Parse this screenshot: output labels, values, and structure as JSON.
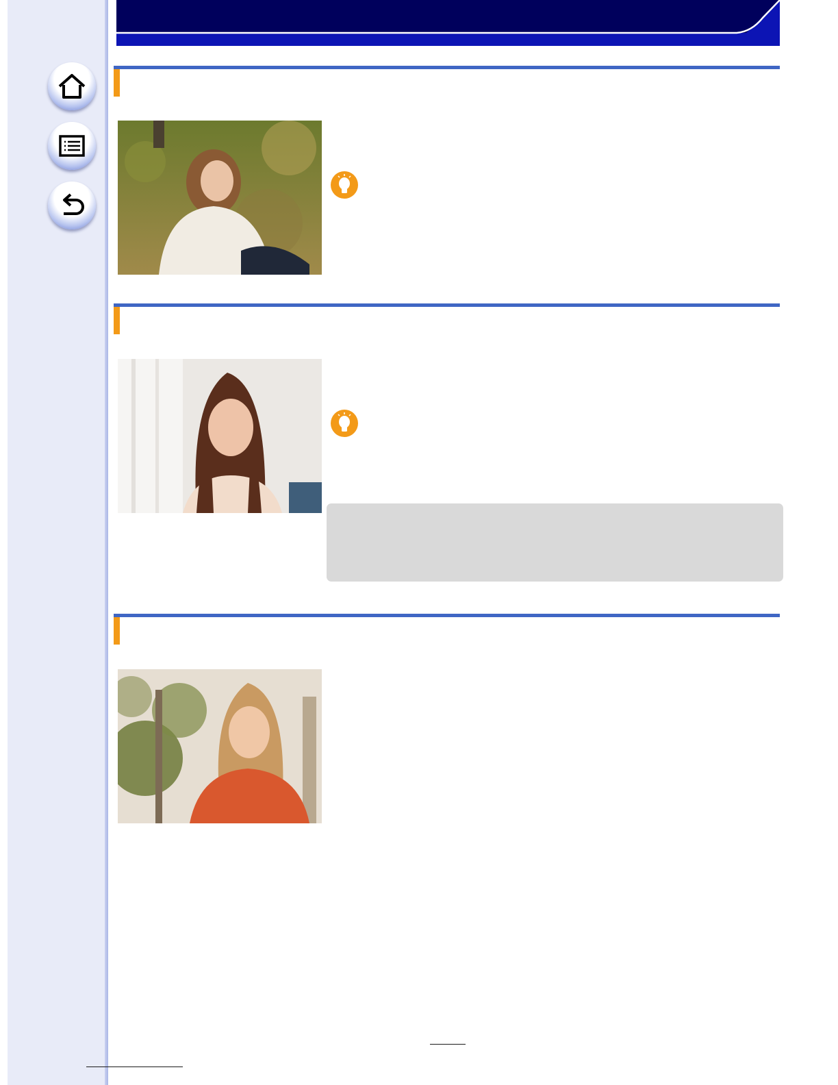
{
  "colors": {
    "header_dark": "#00005c",
    "header_accent": "#0c14b4",
    "section_rule": "#3f66c4",
    "section_marker": "#f39a18",
    "tip_icon": "#f39a18",
    "sidebar": "#e8ebf8",
    "note_box": "#d9d9d9"
  },
  "navigation": [
    {
      "icon": "home-icon"
    },
    {
      "icon": "contents-list-icon"
    },
    {
      "icon": "back-icon"
    }
  ],
  "sections": [
    {
      "photo": "photo-girl-sitting-on-grass",
      "tip_icon": "lightbulb-icon"
    },
    {
      "photo": "photo-woman-indoor-portrait",
      "tip_icon": "lightbulb-icon",
      "note_box": true
    },
    {
      "photo": "photo-girl-backlit-trees"
    }
  ]
}
